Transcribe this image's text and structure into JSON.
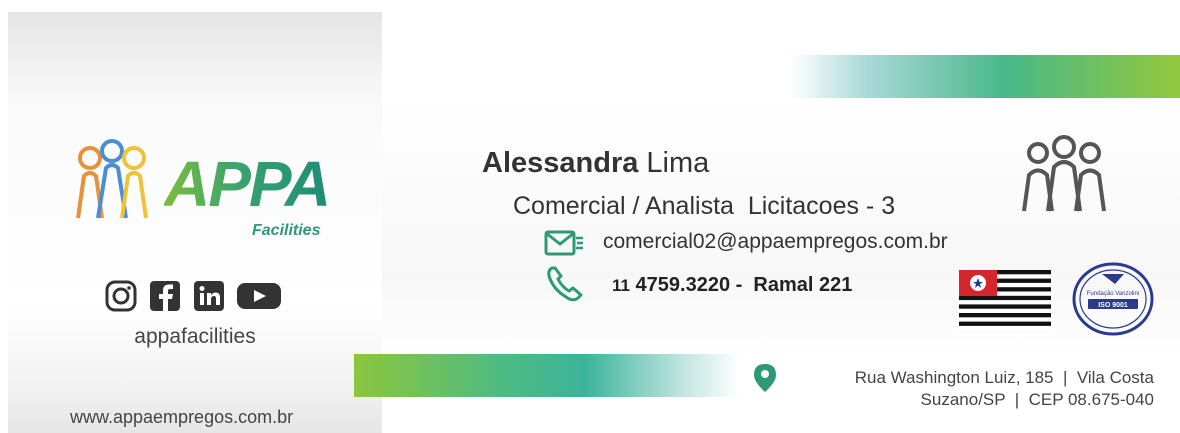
{
  "brand": {
    "name": "APPA",
    "subtitle": "Facilities",
    "colors": {
      "green": "#2e9a75",
      "lime": "#8cc63e",
      "orange": "#e8913a",
      "blue": "#4a8fd1",
      "yellow": "#f0c23a"
    }
  },
  "social": {
    "icons": [
      "instagram-icon",
      "facebook-icon",
      "linkedin-icon",
      "youtube-icon"
    ],
    "handle": "appafacilities"
  },
  "website": "www.appaempregos.com.br",
  "contact": {
    "first_name": "Alessandra",
    "last_name": "Lima",
    "title": "Comercial / Analista  Licitacoes - 3",
    "email": "comercial02@appaempregos.com.br",
    "phone_area": "11",
    "phone_number": "4759.3220 -  Ramal 221"
  },
  "address": {
    "line1": "Rua Washington Luiz, 185  |  Vila Costa",
    "line2": "Suzano/SP  |  CEP 08.675-040"
  },
  "seal": {
    "org": "Fundação Vanzolini",
    "standard": "ISO 9001"
  }
}
